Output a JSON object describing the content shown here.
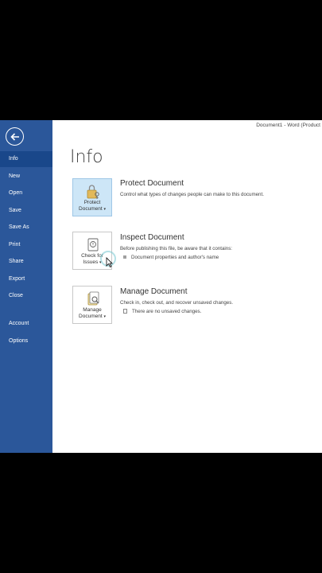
{
  "window": {
    "title": "Document1 - Word (Product"
  },
  "sidebar": {
    "back_icon": "back-arrow-icon",
    "items": [
      {
        "label": "Info",
        "active": true
      },
      {
        "label": "New"
      },
      {
        "label": "Open"
      },
      {
        "label": "Save"
      },
      {
        "label": "Save As"
      },
      {
        "label": "Print"
      },
      {
        "label": "Share"
      },
      {
        "label": "Export"
      },
      {
        "label": "Close"
      },
      {
        "label": "Account"
      },
      {
        "label": "Options"
      }
    ],
    "bg_color": "#2b579a"
  },
  "main": {
    "heading": "Info",
    "sections": [
      {
        "button_line1": "Protect",
        "button_line2": "Document",
        "title": "Protect Document",
        "description": "Control what types of changes people can make to this document.",
        "icon": "lock-key-icon"
      },
      {
        "button_line1": "Check for",
        "button_line2": "Issues",
        "title": "Inspect Document",
        "description": "Before publishing this file, be aware that it contains:",
        "bullets": [
          "Document properties and author's name"
        ],
        "icon": "inspect-icon"
      },
      {
        "button_line1": "Manage",
        "button_line2": "Document",
        "title": "Manage Document",
        "description": "Check in, check out, and recover unsaved changes.",
        "bullets": [
          "There are no unsaved changes."
        ],
        "icon": "manage-versions-icon"
      }
    ]
  }
}
